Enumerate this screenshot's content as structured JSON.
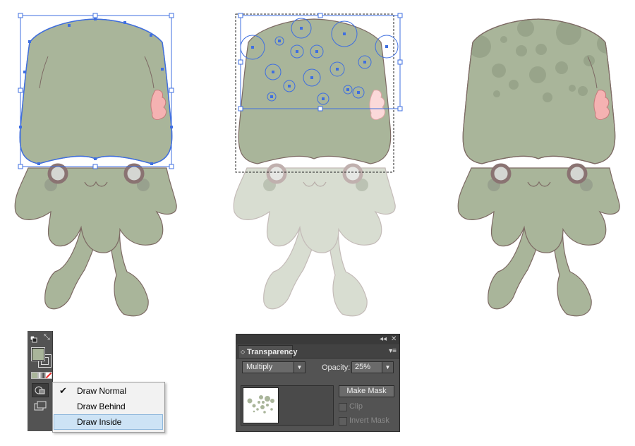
{
  "colors": {
    "squid_body": "#a9b59a",
    "squid_outline": "#7d6a64",
    "squid_spots": "#9aa68b",
    "eye_ring": "#8a7372",
    "eye_fill": "#d4d6d2",
    "cheek": "#98a18e",
    "fin_pink": "#f5b2b2",
    "selection_blue": "#3f6fe0",
    "tools_panel": "#535353"
  },
  "tools_panel": {
    "fill_color": "#a9b59a",
    "swap_icon": "swap-arrow-icon",
    "default_icon": "default-colors-icon",
    "draw_mode_icon": "draw-mode-icon",
    "screen_mode_icon": "screen-mode-icon"
  },
  "draw_menu": {
    "items": [
      {
        "label": "Draw Normal",
        "checked": true
      },
      {
        "label": "Draw Behind",
        "checked": false
      },
      {
        "label": "Draw Inside",
        "checked": false,
        "highlighted": true
      }
    ],
    "check_glyph": "✔"
  },
  "transparency_panel": {
    "collapse_glyph": "◂◂",
    "close_glyph": "✕",
    "tab_arrow": "◇",
    "title": "Transparency",
    "menu_glyph": "▾≡",
    "blend_mode": "Multiply",
    "dropdown_glyph": "▼",
    "opacity_label": "Opacity:",
    "opacity_value": "25%",
    "make_mask_label": "Make Mask",
    "clip_label": "Clip",
    "invert_mask_label": "Invert Mask"
  }
}
